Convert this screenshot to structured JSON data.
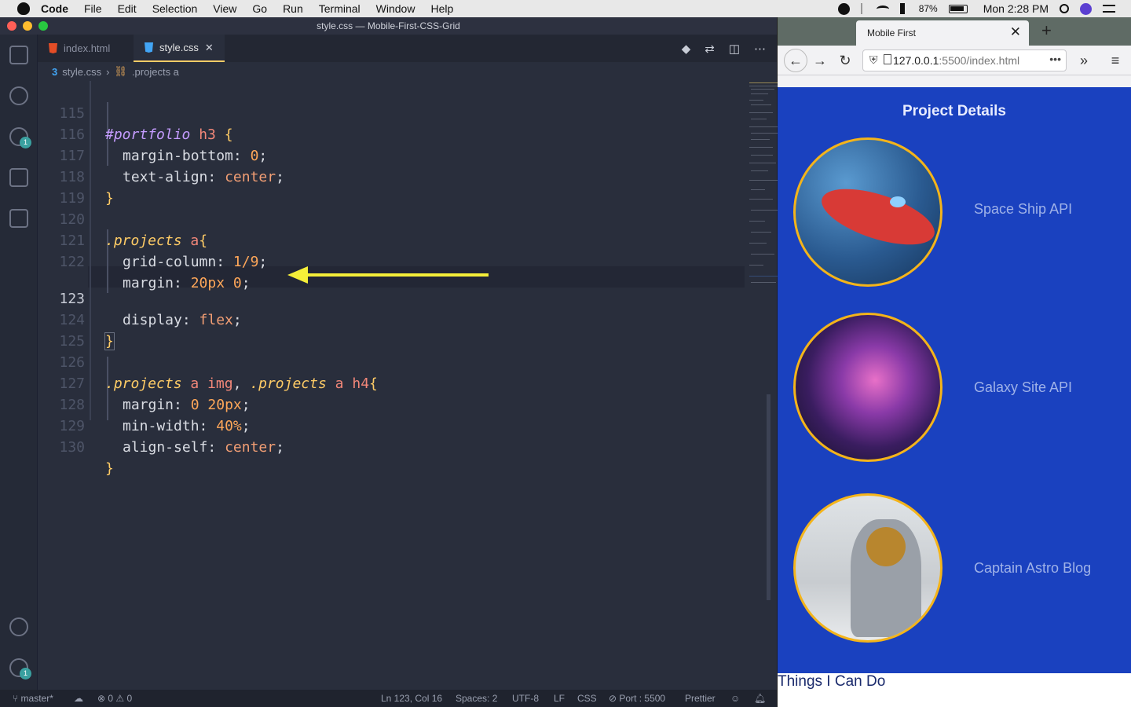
{
  "menubar": {
    "app": "Code",
    "items": [
      "File",
      "Edit",
      "Selection",
      "View",
      "Go",
      "Run",
      "Terminal",
      "Window",
      "Help"
    ],
    "battery": "87%",
    "clock": "Mon 2:28 PM"
  },
  "vscode": {
    "title": "style.css — Mobile-First-CSS-Grid",
    "tabs": [
      {
        "label": "index.html",
        "icon": "html5-icon",
        "active": false
      },
      {
        "label": "style.css",
        "icon": "css3-icon",
        "active": true
      }
    ],
    "breadcrumb": {
      "file": "style.css",
      "symbol": ".projects a"
    },
    "badges": {
      "source_control": "1",
      "settings": "1"
    },
    "lines": [
      "115",
      "116",
      "117",
      "118",
      "119",
      "120",
      "121",
      "122",
      "123",
      "124",
      "125",
      "126",
      "127",
      "128",
      "129",
      "130"
    ],
    "code": {
      "l115": {
        "id": "#portfolio",
        "tag": "h3",
        "brace": "{"
      },
      "l116": {
        "prop": "margin-bottom",
        "val": "0"
      },
      "l117": {
        "prop": "text-align",
        "val": "center"
      },
      "l118": {
        "brace": "}"
      },
      "l120": {
        "sel": ".projects",
        "tag": "a",
        "brace": "{"
      },
      "l121": {
        "prop": "grid-column",
        "val": "1/9"
      },
      "l122": {
        "prop": "margin",
        "val": "20px 0"
      },
      "l123": {
        "prop": "display",
        "val": "flex"
      },
      "l124": {
        "brace": "}"
      },
      "l126": {
        "sel1": ".projects",
        "tag1": "a",
        "tag2": "img",
        "sel2": ".projects",
        "tag3": "a",
        "tag4": "h4",
        "brace": "{"
      },
      "l127": {
        "prop": "margin",
        "val": "0 20px"
      },
      "l128": {
        "prop": "min-width",
        "val": "40%"
      },
      "l129": {
        "prop": "align-self",
        "val": "center"
      },
      "l130": {
        "brace": "}"
      }
    },
    "statusbar": {
      "branch": "master*",
      "errors": "0",
      "warnings": "0",
      "position": "Ln 123, Col 16",
      "spaces": "Spaces: 2",
      "encoding": "UTF-8",
      "eol": "LF",
      "language": "CSS",
      "port": "Port : 5500",
      "formatter": "Prettier"
    }
  },
  "firefox": {
    "tab_title": "Mobile First",
    "url_host": "127.0.0.1",
    "url_rest": ":5500/index.html",
    "page": {
      "heading": "Project Details",
      "projects": [
        {
          "label": "Space Ship API"
        },
        {
          "label": "Galaxy Site API"
        },
        {
          "label": "Captain Astro Blog"
        }
      ],
      "section2": "Things I Can Do"
    }
  }
}
